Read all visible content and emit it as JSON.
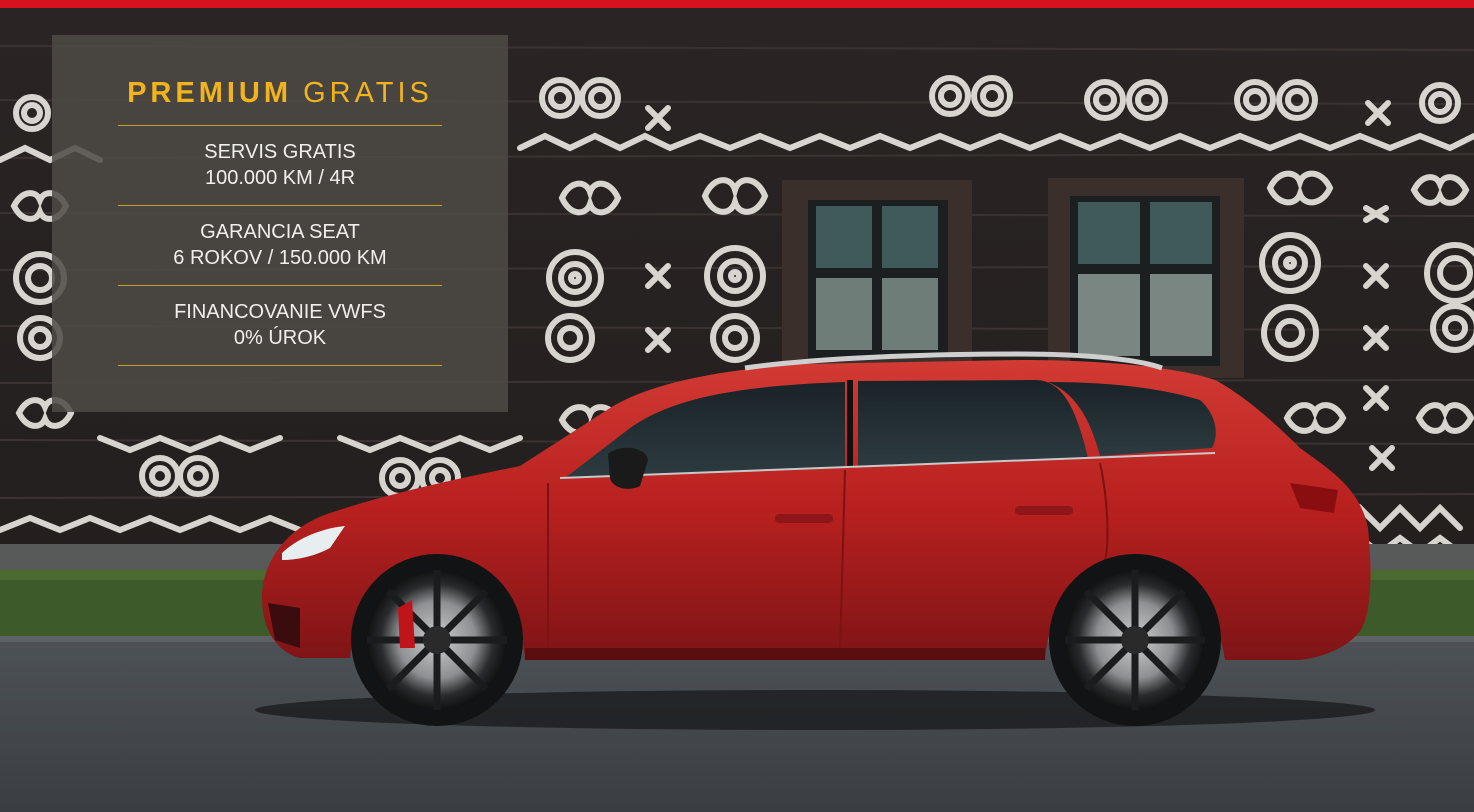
{
  "brand_color": "#d5121e",
  "accent_color": "#f2b31c",
  "promo": {
    "title_strong": "PREMIUM",
    "title_light": "GRATIS",
    "items": [
      {
        "line1": "SERVIS GRATIS",
        "line2": "100.000 KM / 4R"
      },
      {
        "line1": "GARANCIA SEAT",
        "line2": "6 ROKOV / 150.000 KM"
      },
      {
        "line1": "FINANCOVANIE VWFS",
        "line2": "0% ÚROK"
      }
    ]
  },
  "photo": {
    "subject": "red-station-wagon-car",
    "background": "dark-wooden-house-with-white-folk-ornaments"
  }
}
